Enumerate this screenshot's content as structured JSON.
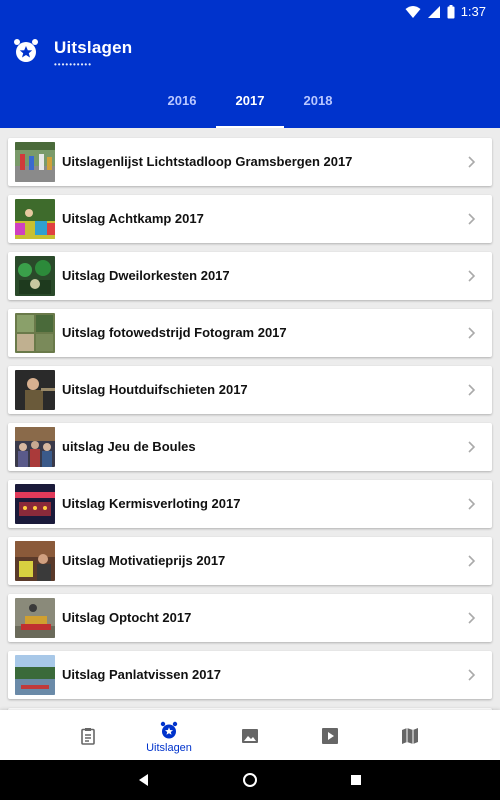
{
  "status": {
    "time": "1:37"
  },
  "header": {
    "title": "Uitslagen",
    "title_dots": "••••••••••"
  },
  "tabs": [
    {
      "label": "2016"
    },
    {
      "label": "2017"
    },
    {
      "label": "2018"
    }
  ],
  "active_tab": "2017",
  "items": [
    {
      "label": "Uitslagenlijst Lichtstadloop Gramsbergen 2017"
    },
    {
      "label": "Uitslag Achtkamp 2017"
    },
    {
      "label": "Uitslag Dweilorkesten 2017"
    },
    {
      "label": "Uitslag fotowedstrijd Fotogram 2017"
    },
    {
      "label": "Uitslag Houtduifschieten 2017"
    },
    {
      "label": "uitslag Jeu de Boules"
    },
    {
      "label": "Uitslag Kermisverloting 2017"
    },
    {
      "label": "Uitslag Motivatieprijs 2017"
    },
    {
      "label": "Uitslag Optocht 2017"
    },
    {
      "label": "Uitslag Panlatvissen 2017"
    }
  ],
  "bottom_nav": {
    "items": [
      {
        "icon": "clipboard-icon"
      },
      {
        "icon": "award-icon",
        "label": "Uitslagen",
        "active": true
      },
      {
        "icon": "image-icon"
      },
      {
        "icon": "video-icon"
      },
      {
        "icon": "map-icon"
      }
    ]
  },
  "colors": {
    "primary": "#0033cc",
    "tab_inactive": "#b9c7ff",
    "background": "#ececec"
  }
}
